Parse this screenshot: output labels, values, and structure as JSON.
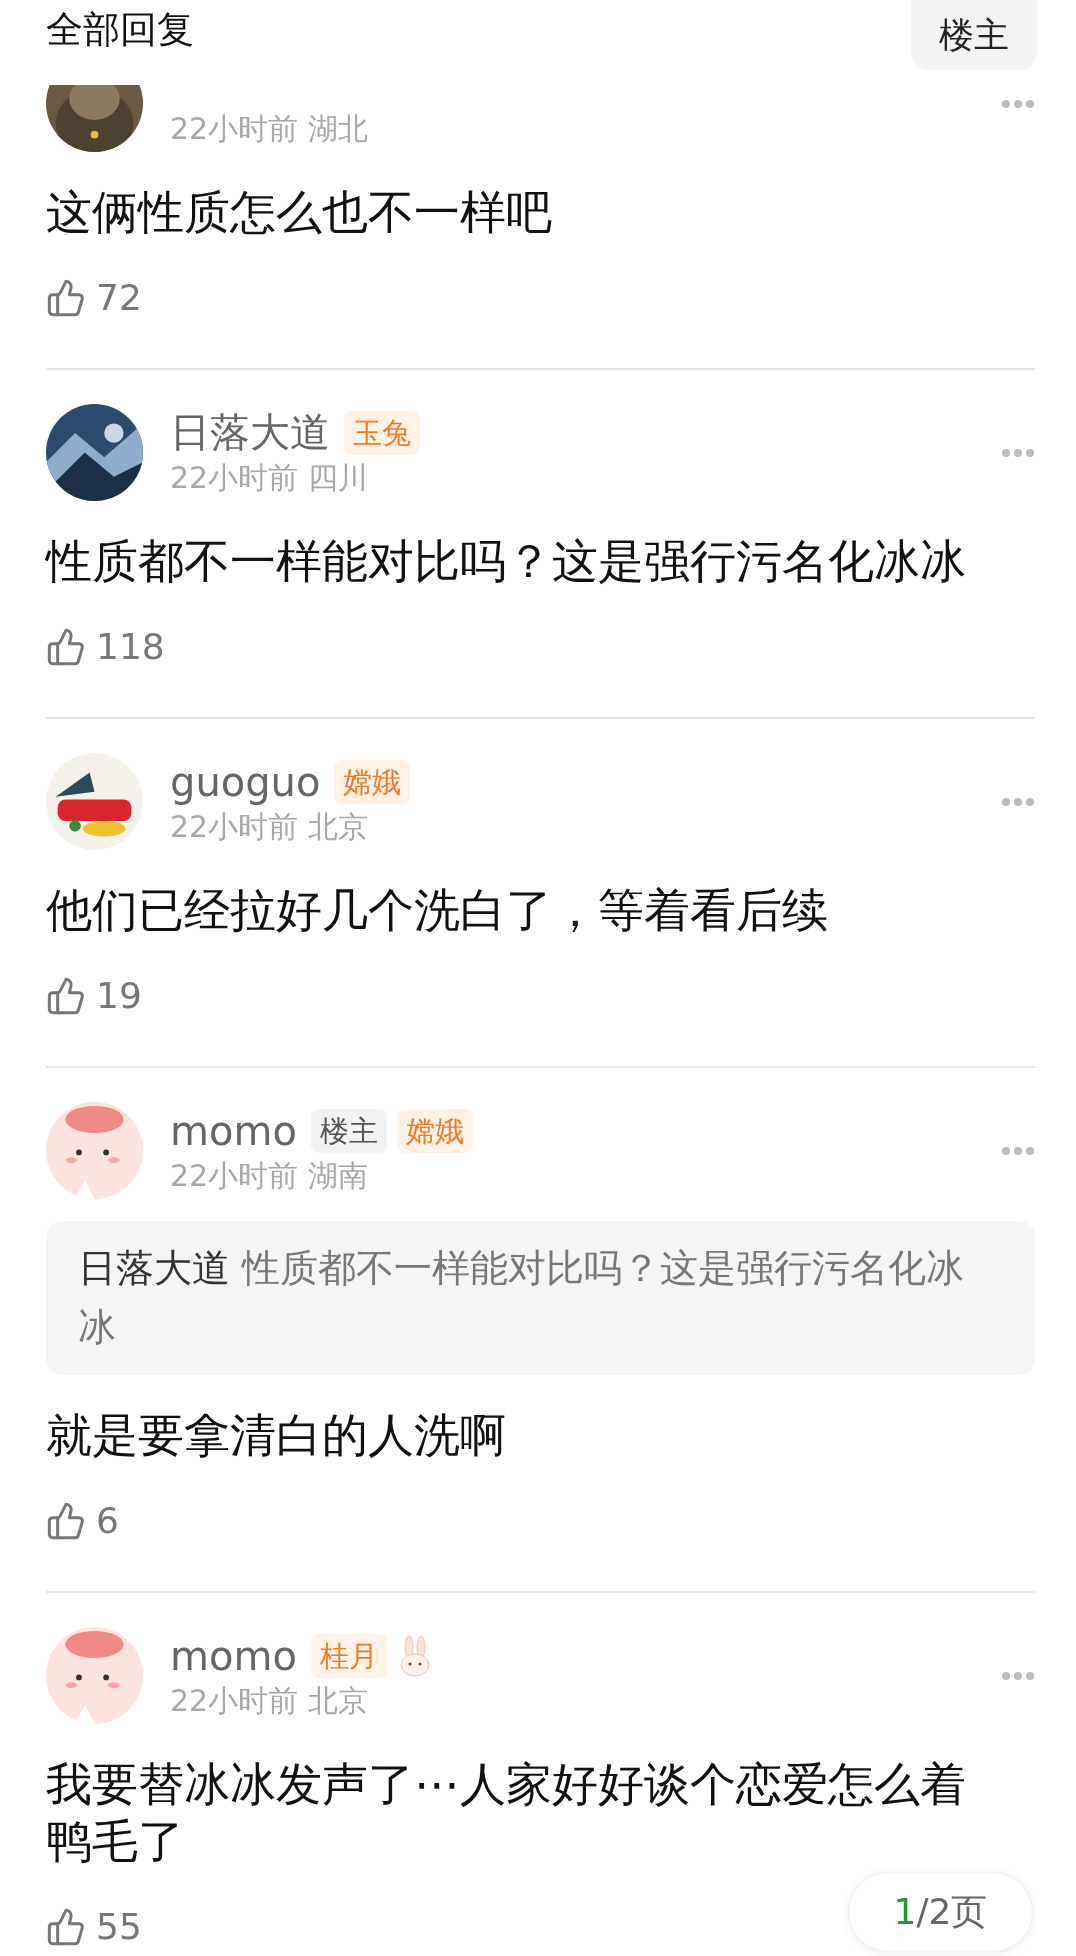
{
  "header": {
    "title": "全部回复",
    "filter_button": "楼主"
  },
  "comments": [
    {
      "avatar": {
        "kind": "picture"
      },
      "meta": "22小时前 湖北",
      "text": "这俩性质怎么也不一样吧",
      "likes": "72"
    },
    {
      "avatar": {
        "kind": "picture"
      },
      "name": "日落大道",
      "badges": [
        {
          "label": "玉兔",
          "kind": "level"
        }
      ],
      "meta": "22小时前 四川",
      "text": "性质都不一样能对比吗？这是强行污名化冰冰",
      "likes": "118"
    },
    {
      "avatar": {
        "kind": "picture"
      },
      "name": "guoguo",
      "badges": [
        {
          "label": "嫦娥",
          "kind": "level"
        }
      ],
      "meta": "22小时前 北京",
      "text": "他们已经拉好几个洗白了，等着看后续",
      "likes": "19"
    },
    {
      "avatar": {
        "kind": "picture"
      },
      "name": "momo",
      "badges": [
        {
          "label": "楼主",
          "kind": "author"
        },
        {
          "label": "嫦娥",
          "kind": "level"
        }
      ],
      "meta": "22小时前 湖南",
      "reply_to": {
        "author": "日落大道",
        "text": "性质都不一样能对比吗？这是强行污名化冰冰"
      },
      "text": "就是要拿清白的人洗啊",
      "likes": "6"
    },
    {
      "avatar": {
        "kind": "picture"
      },
      "name": "momo",
      "badges": [
        {
          "label": "桂月",
          "kind": "level"
        }
      ],
      "sticker": true,
      "meta": "22小时前 北京",
      "text": "我要替冰冰发声了⋯人家好好谈个恋爱怎么着鸭毛了",
      "likes": "55"
    }
  ],
  "pager": {
    "current": "1",
    "total": "/2页"
  }
}
